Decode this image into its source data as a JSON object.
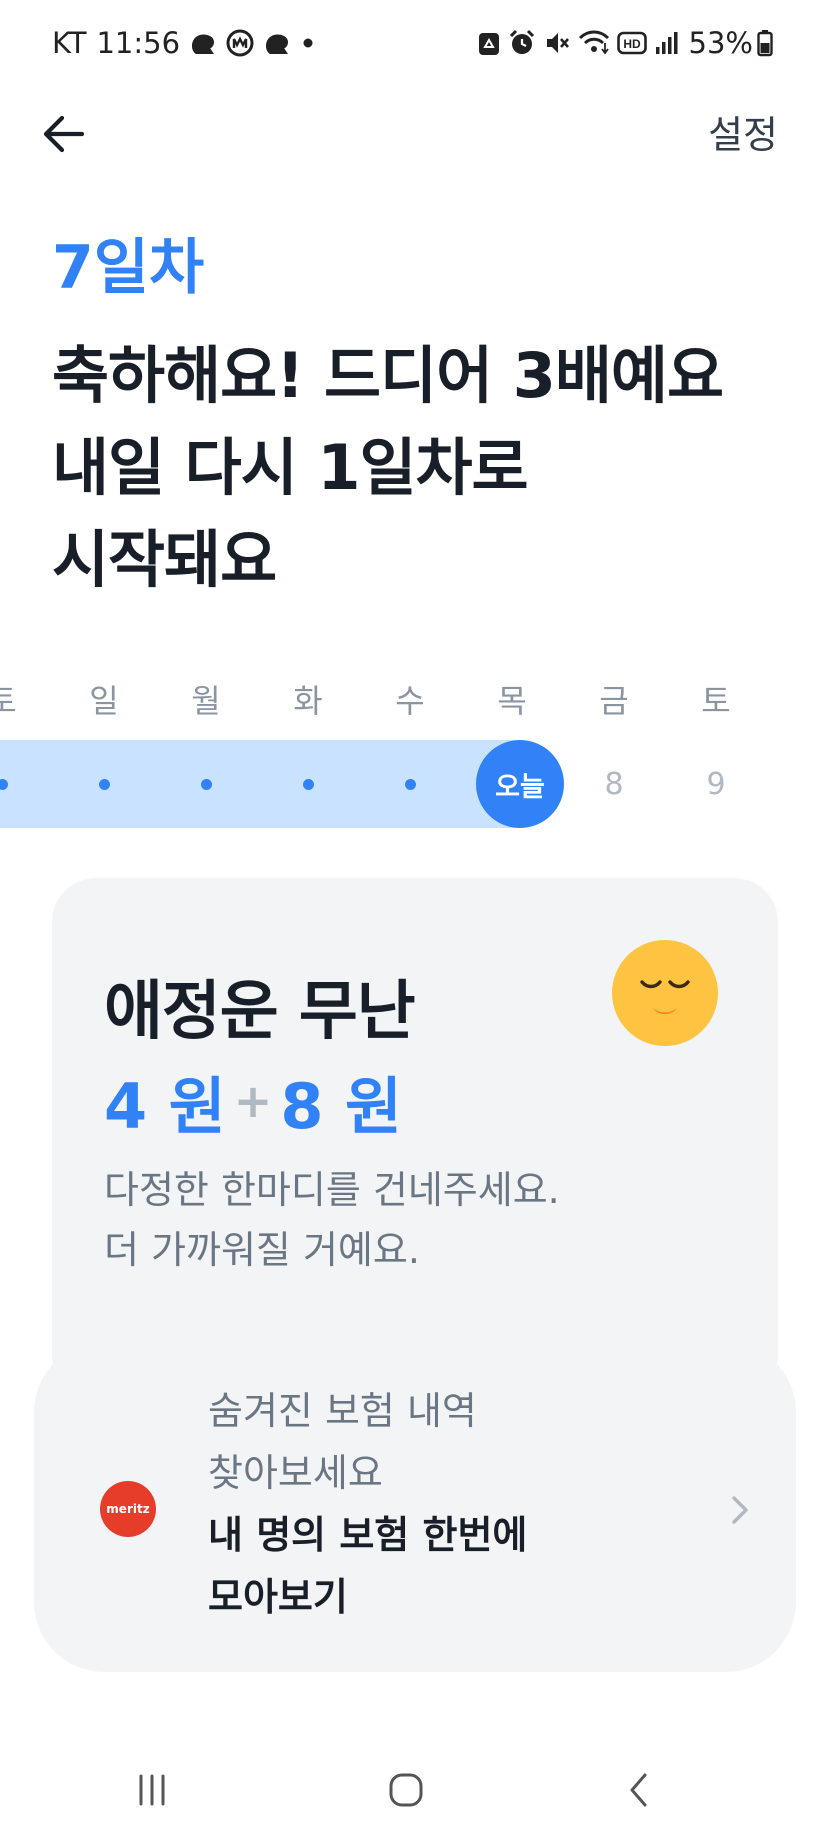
{
  "status_bar": {
    "carrier": "KT",
    "time": "11:56",
    "battery": "53%",
    "icons_left": [
      "threads-icon",
      "mcdonalds-icon",
      "threads-icon",
      "dot-icon"
    ],
    "icons_right": [
      "recycle-icon",
      "alarm-icon",
      "mute-icon",
      "wifi-icon",
      "hd-icon",
      "signal-icon",
      "battery-icon"
    ]
  },
  "header": {
    "back_icon": "arrow-left-icon",
    "settings_label": "설정"
  },
  "streak": {
    "day_label": "7일차",
    "headline_lines": [
      "축하해요! 드디어 3배예요",
      "내일 다시 1일차로",
      "시작돼요"
    ]
  },
  "week": {
    "weekdays": [
      "토",
      "일",
      "월",
      "화",
      "수",
      "목",
      "금",
      "토"
    ],
    "today_label": "오늘",
    "future_dates": [
      "8",
      "9"
    ],
    "completed_days": 6,
    "accent_color": "#3182f6",
    "track_color": "#c9e2ff"
  },
  "mission": {
    "title": "애정운 무난",
    "emoji_icon": "relieved-face-icon",
    "reward_base": "4 원",
    "reward_plus": "+",
    "reward_bonus": "8 원",
    "description_lines": [
      "다정한 한마디를 건네주세요.",
      "더 가까워질 거예요."
    ]
  },
  "ad": {
    "logo_text": "meritz",
    "logo_color": "#e63d2a",
    "subtitle_lines": [
      "숨겨진 보험 내역",
      "찾아보세요"
    ],
    "title_lines": [
      "내 명의 보험 한번에",
      "모아보기"
    ],
    "chevron_icon": "chevron-right-icon"
  },
  "nav": {
    "buttons": [
      "recent-apps-icon",
      "home-icon",
      "back-icon"
    ]
  }
}
